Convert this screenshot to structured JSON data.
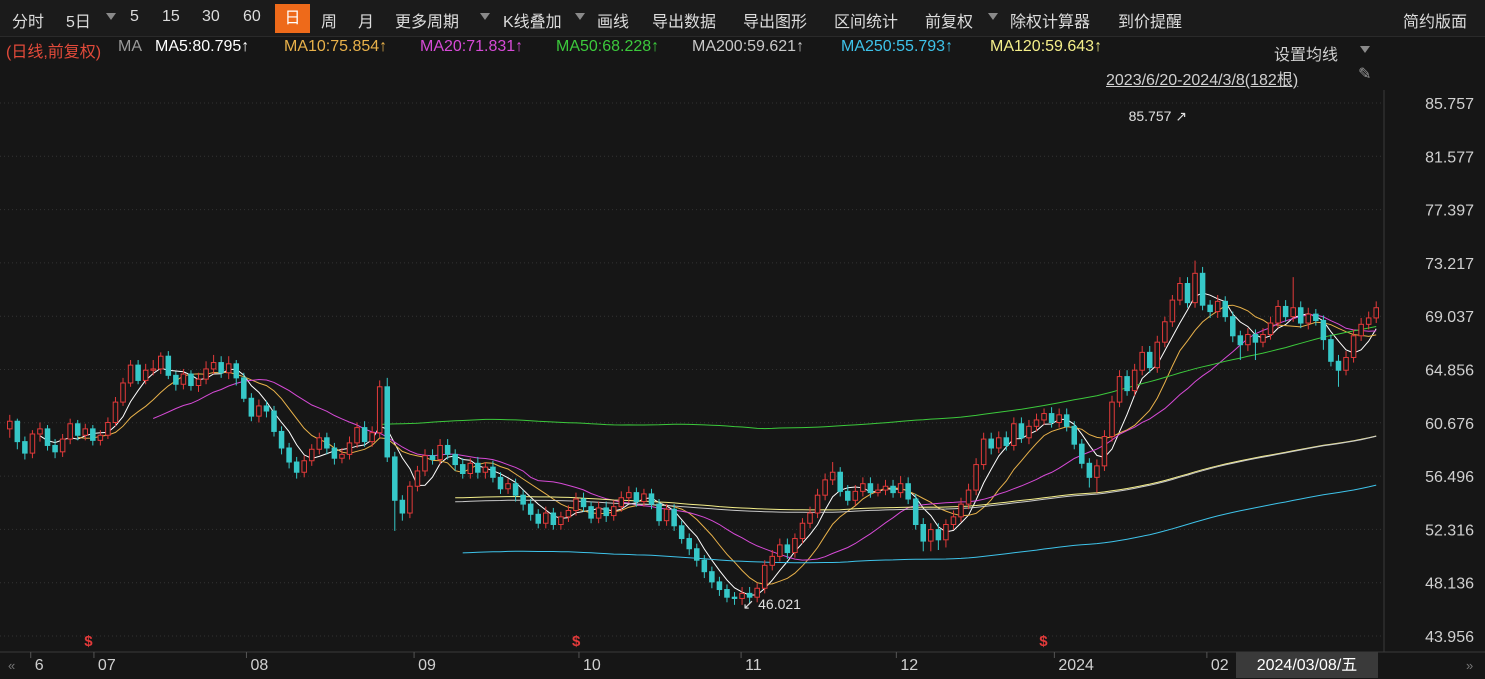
{
  "toolbar": {
    "items": [
      "分时",
      "5日",
      "5",
      "15",
      "30",
      "60",
      "日",
      "周",
      "月",
      "更多周期",
      "K线叠加",
      "画线",
      "导出数据",
      "导出图形",
      "区间统计",
      "前复权",
      "除权计算器",
      "到价提醒"
    ],
    "active": "日",
    "right": "简约版面"
  },
  "ma_legend": {
    "prefix": "(日线,前复权)",
    "ma_label": "MA",
    "entries": [
      {
        "text": "MA5:80.795↑",
        "color": "#ffffff"
      },
      {
        "text": "MA10:75.854↑",
        "color": "#e8b14a"
      },
      {
        "text": "MA20:71.831↑",
        "color": "#d64ad6"
      },
      {
        "text": "MA50:68.228↑",
        "color": "#3cc93c"
      },
      {
        "text": "MA200:59.621↑",
        "color": "#c8c8c8"
      },
      {
        "text": "MA250:55.793↑",
        "color": "#3ec3ea"
      },
      {
        "text": "MA120:59.643↑",
        "color": "#f5ef8a"
      }
    ]
  },
  "settings_label": "设置均线",
  "range_label": "2023/6/20-2024/3/8(182根)",
  "colors": {
    "up": "#e23a3a",
    "down": "#36c8c8",
    "bg": "#161616",
    "grid": "#333333"
  },
  "chart_data": {
    "type": "candlestick",
    "y_axis_ticks": [
      "85.757",
      "81.577",
      "77.397",
      "73.217",
      "69.037",
      "64.856",
      "60.676",
      "56.496",
      "52.316",
      "48.136",
      "43.956"
    ],
    "ylim": [
      43.956,
      85.757
    ],
    "x_axis_labels": [
      "6",
      "07",
      "08",
      "09",
      "10",
      "11",
      "12",
      "2024",
      "02"
    ],
    "crosshair_date": "2024/03/08/五",
    "annotations": [
      {
        "text": "85.757",
        "type": "high"
      },
      {
        "text": "46.021",
        "type": "low"
      }
    ],
    "ex_rights_marker": "$",
    "moving_average_last": {
      "MA5": 80.795,
      "MA10": 75.854,
      "MA20": 71.831,
      "MA50": 68.228,
      "MA200": 59.621,
      "MA250": 55.793,
      "MA120": 59.643
    },
    "candles": [
      [
        60.2,
        60.8,
        61.3,
        59.5
      ],
      [
        60.8,
        59.2,
        61.0,
        58.6
      ],
      [
        59.2,
        58.3,
        59.6,
        57.8
      ],
      [
        58.3,
        59.8,
        60.1,
        57.9
      ],
      [
        59.8,
        60.2,
        60.7,
        59.2
      ],
      [
        60.2,
        58.9,
        60.5,
        58.5
      ],
      [
        58.9,
        58.4,
        59.4,
        57.9
      ],
      [
        58.4,
        59.4,
        59.8,
        58.0
      ],
      [
        59.4,
        60.6,
        61.0,
        59.0
      ],
      [
        60.6,
        59.7,
        60.9,
        59.3
      ],
      [
        59.7,
        60.2,
        60.6,
        59.3
      ],
      [
        60.2,
        59.3,
        60.5,
        58.9
      ],
      [
        59.3,
        59.7,
        60.1,
        58.9
      ],
      [
        59.7,
        60.7,
        61.1,
        59.4
      ],
      [
        60.7,
        62.3,
        62.7,
        60.4
      ],
      [
        62.3,
        63.8,
        64.2,
        62.0
      ],
      [
        63.8,
        65.2,
        65.6,
        63.5
      ],
      [
        65.2,
        64.0,
        65.6,
        63.7
      ],
      [
        64.0,
        64.8,
        65.3,
        63.7
      ],
      [
        64.8,
        64.9,
        65.6,
        64.4
      ],
      [
        64.9,
        65.9,
        66.2,
        64.5
      ],
      [
        65.9,
        64.4,
        66.3,
        64.1
      ],
      [
        64.4,
        63.7,
        64.7,
        63.2
      ],
      [
        63.7,
        64.5,
        64.9,
        63.3
      ],
      [
        64.5,
        63.6,
        64.8,
        63.2
      ],
      [
        63.6,
        64.1,
        64.6,
        63.1
      ],
      [
        64.1,
        64.9,
        65.5,
        63.7
      ],
      [
        64.9,
        65.4,
        66.0,
        64.5
      ],
      [
        65.4,
        64.6,
        65.9,
        64.2
      ],
      [
        64.6,
        65.3,
        65.9,
        64.1
      ],
      [
        65.3,
        64.2,
        65.6,
        63.6
      ],
      [
        64.2,
        62.6,
        64.6,
        62.3
      ],
      [
        62.6,
        61.2,
        63.0,
        60.8
      ],
      [
        61.2,
        62.0,
        62.5,
        60.7
      ],
      [
        62.0,
        61.6,
        62.4,
        61.1
      ],
      [
        61.6,
        60.0,
        62.0,
        59.6
      ],
      [
        60.0,
        58.7,
        60.4,
        58.2
      ],
      [
        58.7,
        57.6,
        59.1,
        57.1
      ],
      [
        57.6,
        56.8,
        58.0,
        56.3
      ],
      [
        56.8,
        57.7,
        58.1,
        56.4
      ],
      [
        57.7,
        58.6,
        59.0,
        57.3
      ],
      [
        58.6,
        59.5,
        59.9,
        58.2
      ],
      [
        59.5,
        58.7,
        59.9,
        58.2
      ],
      [
        58.7,
        57.9,
        59.1,
        57.4
      ],
      [
        57.9,
        58.2,
        58.7,
        57.5
      ],
      [
        58.2,
        59.1,
        59.6,
        57.8
      ],
      [
        59.1,
        60.3,
        60.7,
        58.7
      ],
      [
        60.3,
        59.2,
        60.8,
        58.8
      ],
      [
        59.2,
        59.9,
        60.4,
        58.8
      ],
      [
        59.9,
        63.5,
        64.0,
        59.5
      ],
      [
        63.5,
        58.0,
        64.2,
        57.6
      ],
      [
        58.0,
        54.6,
        58.4,
        52.2
      ],
      [
        54.6,
        53.6,
        55.0,
        53.0
      ],
      [
        53.6,
        55.7,
        56.1,
        53.2
      ],
      [
        55.7,
        56.9,
        57.3,
        55.3
      ],
      [
        56.9,
        58.1,
        58.6,
        56.5
      ],
      [
        58.1,
        57.8,
        58.6,
        57.4
      ],
      [
        57.8,
        58.9,
        59.4,
        57.4
      ],
      [
        58.9,
        58.2,
        59.4,
        57.8
      ],
      [
        58.2,
        57.4,
        58.6,
        56.9
      ],
      [
        57.4,
        56.7,
        57.9,
        56.3
      ],
      [
        56.7,
        57.5,
        57.9,
        56.3
      ],
      [
        57.5,
        56.8,
        58.0,
        56.3
      ],
      [
        56.8,
        57.2,
        57.6,
        56.3
      ],
      [
        57.2,
        56.4,
        57.7,
        56.0
      ],
      [
        56.4,
        55.5,
        56.8,
        55.1
      ],
      [
        55.5,
        55.9,
        56.3,
        55.1
      ],
      [
        55.9,
        55.0,
        56.3,
        54.5
      ],
      [
        55.0,
        54.3,
        55.4,
        53.8
      ],
      [
        54.3,
        53.5,
        54.7,
        53.0
      ],
      [
        53.5,
        52.8,
        53.9,
        52.4
      ],
      [
        52.8,
        53.6,
        54.1,
        52.4
      ],
      [
        53.6,
        52.7,
        54.0,
        52.3
      ],
      [
        52.7,
        53.3,
        53.7,
        52.3
      ],
      [
        53.3,
        53.8,
        54.2,
        52.9
      ],
      [
        53.8,
        54.7,
        55.2,
        53.4
      ],
      [
        54.7,
        54.1,
        55.2,
        53.7
      ],
      [
        54.1,
        53.2,
        54.5,
        52.8
      ],
      [
        53.2,
        54.0,
        54.5,
        52.8
      ],
      [
        54.0,
        53.4,
        54.5,
        52.9
      ],
      [
        53.4,
        54.1,
        54.6,
        53.0
      ],
      [
        54.1,
        54.8,
        55.3,
        53.7
      ],
      [
        54.8,
        55.2,
        55.7,
        54.4
      ],
      [
        55.2,
        54.5,
        55.6,
        54.1
      ],
      [
        54.5,
        55.1,
        55.5,
        54.1
      ],
      [
        55.1,
        54.3,
        55.5,
        53.9
      ],
      [
        54.3,
        53.0,
        54.7,
        52.6
      ],
      [
        53.0,
        53.9,
        54.3,
        52.6
      ],
      [
        53.9,
        52.6,
        54.3,
        52.2
      ],
      [
        52.6,
        51.6,
        53.0,
        51.2
      ],
      [
        51.6,
        50.8,
        52.0,
        50.3
      ],
      [
        50.8,
        49.9,
        51.2,
        49.4
      ],
      [
        49.9,
        49.0,
        50.3,
        48.5
      ],
      [
        49.0,
        48.2,
        49.4,
        47.7
      ],
      [
        48.2,
        47.6,
        48.6,
        47.1
      ],
      [
        47.6,
        47.0,
        48.0,
        46.6
      ],
      [
        47.0,
        46.9,
        47.4,
        46.4
      ],
      [
        46.9,
        47.3,
        47.8,
        46.4
      ],
      [
        47.3,
        47.0,
        47.8,
        46.5
      ],
      [
        47.0,
        47.7,
        48.1,
        46.6
      ],
      [
        47.7,
        49.5,
        49.9,
        47.3
      ],
      [
        49.5,
        50.2,
        50.7,
        49.1
      ],
      [
        50.2,
        51.1,
        51.6,
        49.8
      ],
      [
        51.1,
        50.5,
        51.6,
        50.0
      ],
      [
        50.5,
        51.6,
        52.0,
        50.1
      ],
      [
        51.6,
        52.8,
        53.2,
        51.2
      ],
      [
        52.8,
        53.6,
        54.1,
        52.4
      ],
      [
        53.6,
        55.0,
        55.5,
        53.2
      ],
      [
        55.0,
        56.2,
        56.7,
        54.6
      ],
      [
        56.2,
        56.8,
        57.6,
        55.8
      ],
      [
        56.8,
        55.3,
        57.2,
        54.9
      ],
      [
        55.3,
        54.6,
        55.8,
        54.2
      ],
      [
        54.6,
        55.3,
        55.8,
        54.2
      ],
      [
        55.3,
        55.9,
        56.4,
        54.9
      ],
      [
        55.9,
        55.2,
        56.4,
        54.8
      ],
      [
        55.2,
        55.4,
        55.9,
        54.9
      ],
      [
        55.4,
        55.7,
        56.2,
        55.0
      ],
      [
        55.7,
        55.2,
        56.2,
        54.8
      ],
      [
        55.2,
        55.9,
        56.5,
        54.8
      ],
      [
        55.9,
        54.7,
        56.4,
        54.3
      ],
      [
        54.7,
        52.7,
        55.1,
        52.3
      ],
      [
        52.7,
        51.4,
        53.2,
        50.6
      ],
      [
        51.4,
        52.3,
        52.8,
        50.6
      ],
      [
        52.3,
        51.5,
        52.8,
        50.7
      ],
      [
        51.5,
        52.7,
        53.1,
        50.9
      ],
      [
        52.7,
        53.3,
        53.8,
        52.3
      ],
      [
        53.3,
        54.3,
        54.8,
        52.9
      ],
      [
        54.3,
        55.4,
        55.9,
        53.9
      ],
      [
        55.4,
        57.4,
        57.9,
        55.0
      ],
      [
        57.4,
        59.4,
        59.9,
        57.0
      ],
      [
        59.4,
        58.7,
        59.9,
        58.2
      ],
      [
        58.7,
        59.5,
        60.0,
        58.3
      ],
      [
        59.5,
        58.9,
        60.0,
        58.5
      ],
      [
        58.9,
        60.6,
        61.1,
        58.5
      ],
      [
        60.6,
        59.5,
        61.1,
        59.1
      ],
      [
        59.5,
        60.4,
        60.9,
        59.0
      ],
      [
        60.4,
        60.9,
        61.4,
        60.0
      ],
      [
        60.9,
        61.4,
        61.8,
        60.5
      ],
      [
        61.4,
        60.7,
        61.9,
        60.3
      ],
      [
        60.7,
        61.3,
        61.8,
        60.3
      ],
      [
        61.3,
        60.4,
        61.8,
        60.0
      ],
      [
        60.4,
        59.0,
        60.8,
        58.6
      ],
      [
        59.0,
        57.5,
        59.4,
        57.1
      ],
      [
        57.5,
        56.4,
        57.9,
        55.6
      ],
      [
        56.4,
        57.3,
        57.8,
        55.2
      ],
      [
        57.3,
        59.6,
        60.1,
        56.9
      ],
      [
        59.6,
        62.3,
        62.8,
        59.2
      ],
      [
        62.3,
        64.3,
        64.8,
        61.9
      ],
      [
        64.3,
        63.2,
        64.8,
        62.8
      ],
      [
        63.2,
        64.8,
        65.3,
        62.8
      ],
      [
        64.8,
        66.2,
        66.7,
        64.4
      ],
      [
        66.2,
        65.0,
        66.7,
        64.6
      ],
      [
        65.0,
        67.0,
        67.5,
        64.6
      ],
      [
        67.0,
        68.6,
        69.0,
        66.6
      ],
      [
        68.6,
        70.3,
        70.7,
        68.2
      ],
      [
        70.3,
        71.6,
        72.1,
        69.9
      ],
      [
        71.6,
        70.1,
        72.1,
        69.7
      ],
      [
        70.1,
        72.4,
        73.4,
        69.7
      ],
      [
        72.4,
        69.9,
        72.9,
        69.5
      ],
      [
        69.9,
        69.4,
        70.3,
        68.9
      ],
      [
        69.4,
        70.2,
        70.7,
        68.9
      ],
      [
        70.2,
        69.0,
        70.6,
        68.6
      ],
      [
        69.0,
        67.5,
        69.4,
        67.0
      ],
      [
        67.5,
        66.8,
        67.9,
        65.6
      ],
      [
        66.8,
        67.6,
        68.1,
        66.3
      ],
      [
        67.6,
        67.0,
        68.0,
        65.6
      ],
      [
        67.0,
        67.6,
        68.1,
        66.6
      ],
      [
        67.6,
        68.5,
        69.0,
        67.2
      ],
      [
        68.5,
        69.8,
        70.3,
        68.1
      ],
      [
        69.8,
        69.0,
        70.3,
        68.6
      ],
      [
        69.0,
        69.7,
        72.1,
        68.6
      ],
      [
        69.7,
        68.5,
        70.2,
        68.1
      ],
      [
        68.5,
        69.2,
        69.7,
        68.0
      ],
      [
        69.2,
        68.7,
        69.6,
        68.3
      ],
      [
        68.7,
        67.2,
        69.1,
        66.4
      ],
      [
        67.2,
        65.5,
        67.6,
        65.1
      ],
      [
        65.5,
        64.8,
        66.0,
        63.5
      ],
      [
        64.8,
        65.8,
        66.3,
        64.4
      ],
      [
        65.8,
        67.5,
        68.0,
        65.4
      ],
      [
        67.5,
        68.4,
        68.9,
        67.1
      ],
      [
        68.4,
        68.9,
        69.4,
        68.0
      ],
      [
        68.9,
        69.7,
        70.2,
        68.5
      ]
    ]
  }
}
